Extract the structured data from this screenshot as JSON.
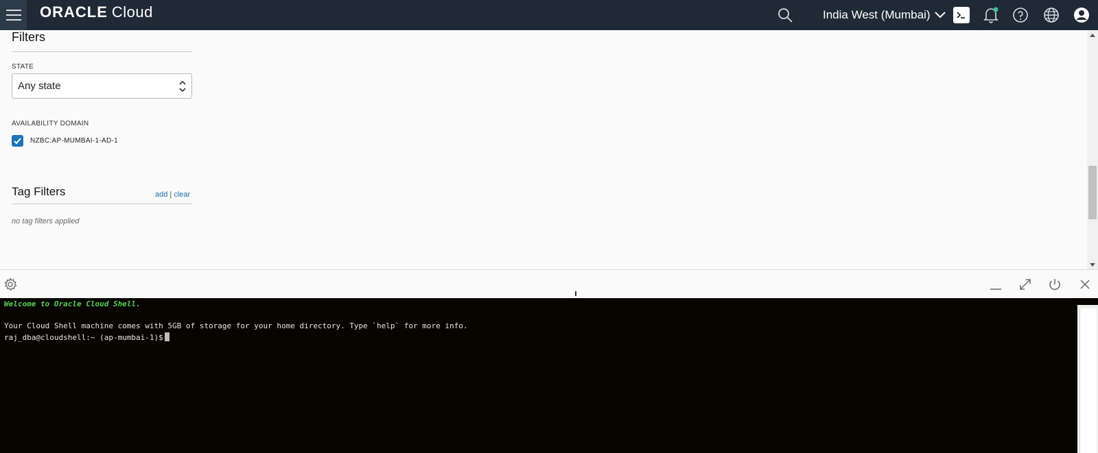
{
  "header": {
    "brand_primary": "ORACLE",
    "brand_secondary": "Cloud",
    "region": "India West (Mumbai)",
    "icons": [
      "menu-icon",
      "search-icon",
      "chevron-down-icon",
      "cloud-shell-icon",
      "bell-icon",
      "help-icon",
      "globe-icon",
      "user-icon"
    ],
    "notification_dot_color": "#3fbf8f"
  },
  "filters": {
    "title": "Filters",
    "state_label": "STATE",
    "state_value": "Any state",
    "availability_domain_label": "AVAILABILITY DOMAIN",
    "availability_domain_option": "NZBC:AP-MUMBAI-1-AD-1",
    "availability_domain_checked": true
  },
  "tag_filters": {
    "title": "Tag Filters",
    "add_label": "add",
    "separator": "|",
    "clear_label": "clear",
    "empty_text": "no tag filters applied"
  },
  "shell_toolbar": {
    "icons": [
      "settings-icon",
      "minimize-icon",
      "maximize-icon",
      "restart-icon",
      "close-icon"
    ]
  },
  "terminal": {
    "welcome": "Welcome to Oracle Cloud Shell.",
    "info": "Your Cloud Shell machine comes with 5GB of storage for your home directory. Type `help` for more info.",
    "prompt": "raj_dba@cloudshell:~ (ap-mumbai-1)$"
  },
  "colors": {
    "topbar_bg": "#1f2a36",
    "accent_blue": "#1b75bb",
    "terminal_bg": "#080400",
    "terminal_welcome": "#4fd24f"
  }
}
